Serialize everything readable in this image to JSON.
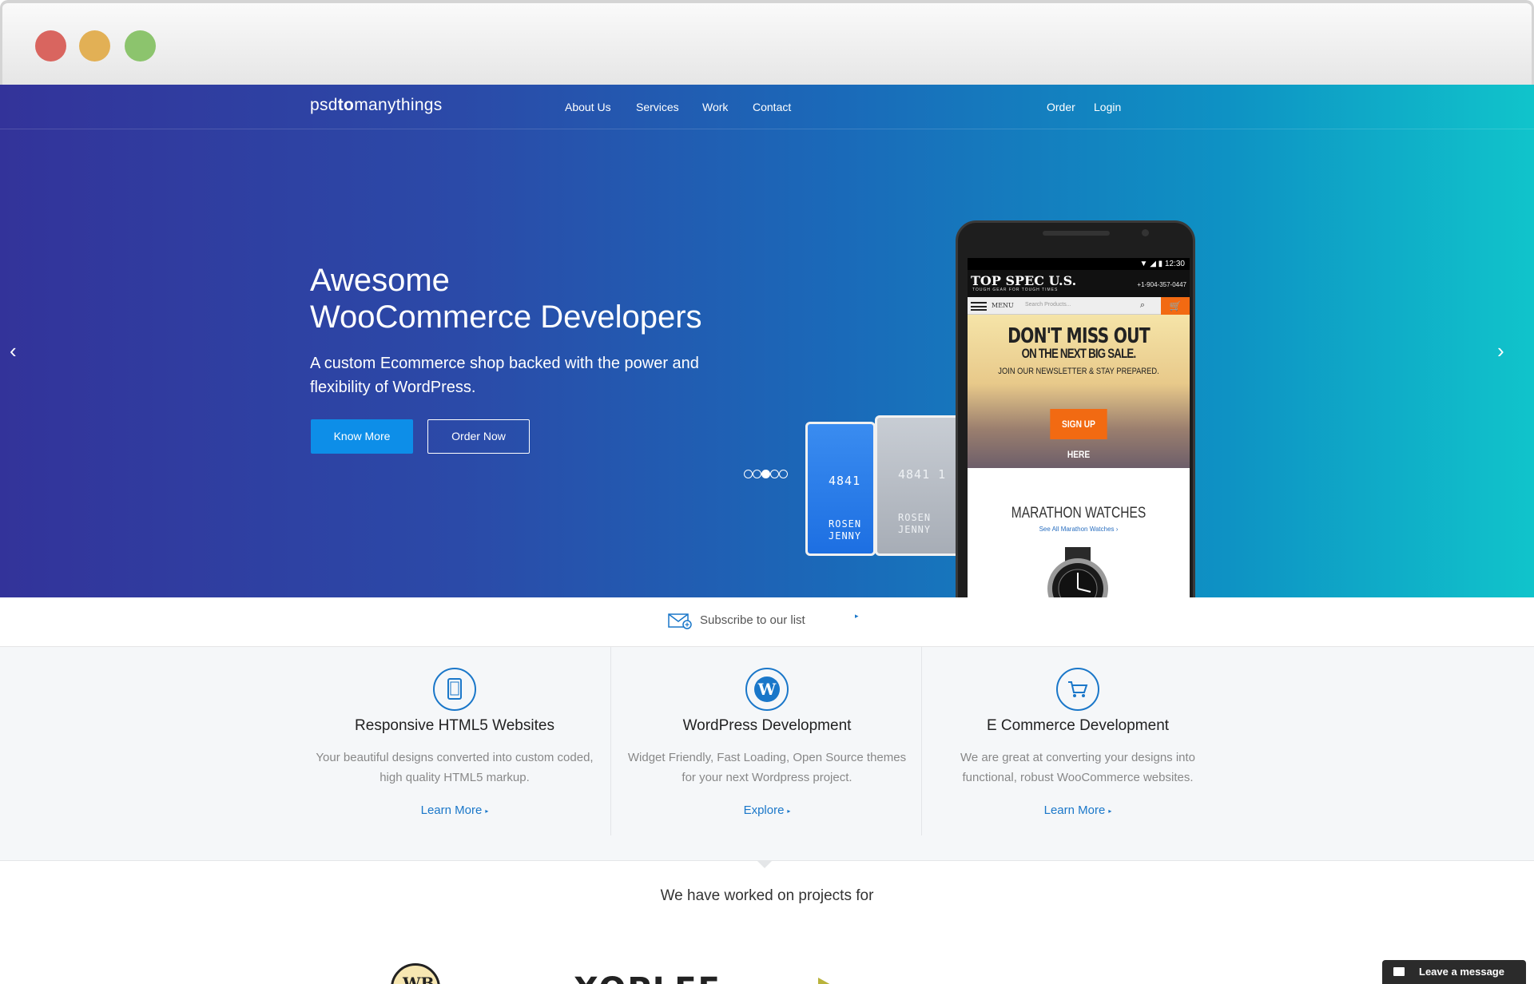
{
  "colors": {
    "hero_start": "#33339a",
    "hero_end": "#10c4cb",
    "accent": "#1a77c9",
    "button_primary": "#0d8ee8",
    "dot_close": "#d9655f",
    "dot_minimize": "#e2b055",
    "dot_zoom": "#8cc46d",
    "orange": "#f26a12"
  },
  "nav": {
    "logo_prefix": "psd",
    "logo_bold": "to",
    "logo_suffix": "manythings",
    "links": [
      "About Us",
      "Services",
      "Work",
      "Contact"
    ],
    "right_links": [
      "Order",
      "Login"
    ]
  },
  "hero": {
    "title_line1": "Awesome",
    "title_line2": "WooCommerce Developers",
    "subtitle": "A custom Ecommerce shop backed with the power and flexibility of WordPress.",
    "primary_button": "Know More",
    "secondary_button": "Order Now",
    "prev_arrow": "‹",
    "next_arrow": "›",
    "slide_count": 4,
    "active_slide": 2
  },
  "cards": [
    {
      "number": "4841",
      "name_line1": "ROSEN",
      "name_line2": "JENNY"
    },
    {
      "number": "4841 1",
      "name_line1": "ROSEN",
      "name_line2": "JENNY"
    }
  ],
  "phone": {
    "time": "12:30",
    "shop_name": "TOP SPEC U.S.",
    "shop_tagline": "TOUGH GEAR FOR TOUGH TIMES",
    "shop_phone": "+1-904-357-0447",
    "menu_label": "MENU",
    "search_placeholder": "Search Products...",
    "promo_line1": "DON'T MISS OUT",
    "promo_line2": "ON THE NEXT BIG SALE.",
    "promo_line3": "JOIN OUR NEWSLETTER & STAY PREPARED.",
    "promo_button": "SIGN UP HERE",
    "section_title": "MARATHON WATCHES",
    "section_link": "See All Marathon Watches ›"
  },
  "subscribe": {
    "label": "Subscribe to our list",
    "arrow": "▸"
  },
  "services": [
    {
      "icon": "tablet-icon",
      "title": "Responsive HTML5 Websites",
      "description": "Your beautiful designs converted into custom coded, high quality HTML5 markup.",
      "link": "Learn More"
    },
    {
      "icon": "wordpress-icon",
      "title": "WordPress Development",
      "description": "Widget Friendly, Fast Loading, Open Source themes for your next Wordpress project.",
      "link": "Explore"
    },
    {
      "icon": "cart-icon",
      "title": "E Commerce Development",
      "description": "We are great at converting your designs into functional, robust WooCommerce websites.",
      "link": "Learn More"
    }
  ],
  "clients": {
    "heading": "We have worked on projects for",
    "logos": [
      "WB",
      "XOPLEE"
    ]
  },
  "chat": {
    "label": "Leave a message"
  }
}
